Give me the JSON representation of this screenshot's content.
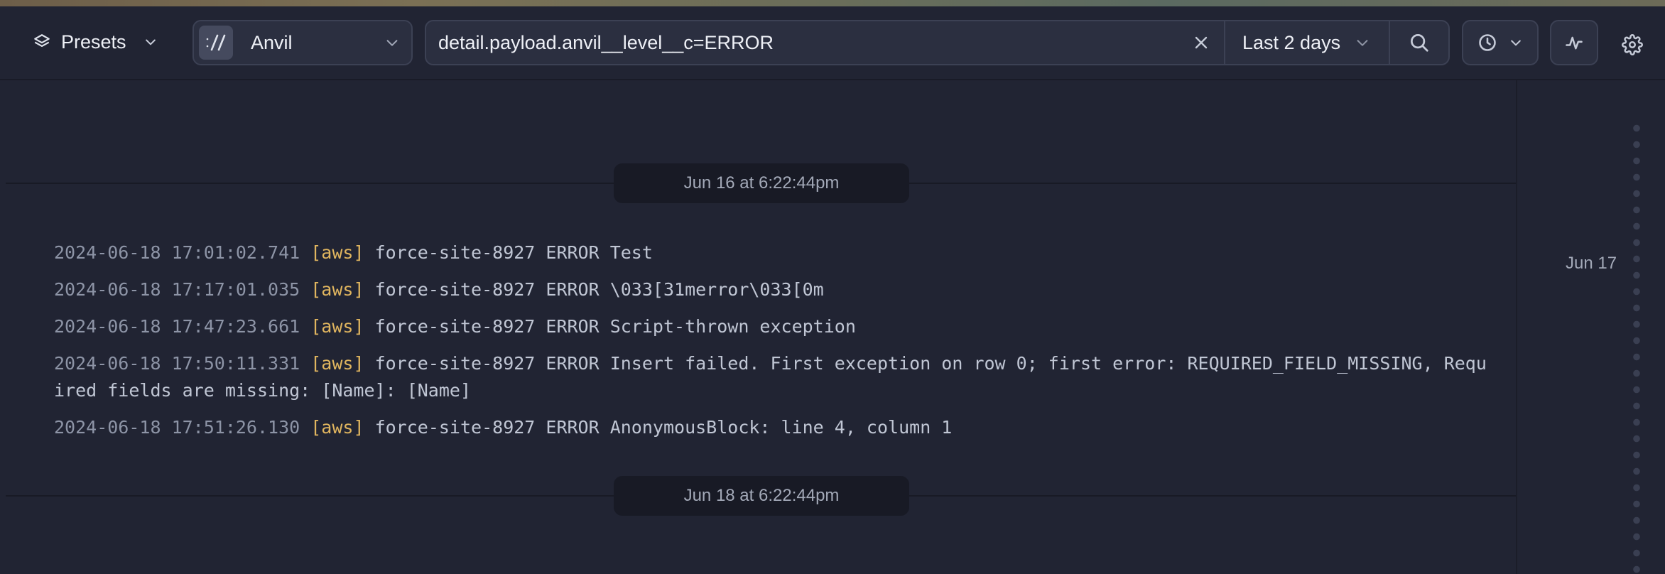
{
  "toolbar": {
    "presets_label": "Presets",
    "source_label": "Anvil",
    "query": "detail.payload.anvil__level__c=ERROR",
    "time_range": "Last 2 days"
  },
  "icons": {
    "presets": "layers-icon",
    "source": "slashes-icon",
    "clear": "close-icon",
    "search": "search-icon",
    "live": "clock-icon",
    "histogram": "activity-icon",
    "settings": "gear-icon"
  },
  "log": {
    "dividers": [
      "Jun 16 at 6:22:44pm",
      "Jun 18 at 6:22:44pm"
    ],
    "entries": [
      {
        "ts": "2024-06-18 17:01:02.741",
        "tag": "[aws]",
        "msg": "force-site-8927 ERROR Test"
      },
      {
        "ts": "2024-06-18 17:17:01.035",
        "tag": "[aws]",
        "msg": "force-site-8927 ERROR \\033[31merror\\033[0m"
      },
      {
        "ts": "2024-06-18 17:47:23.661",
        "tag": "[aws]",
        "msg": "force-site-8927 ERROR Script-thrown exception"
      },
      {
        "ts": "2024-06-18 17:50:11.331",
        "tag": "[aws]",
        "msg": "force-site-8927 ERROR Insert failed. First exception on row 0; first error: REQUIRED_FIELD_MISSING, Required fields are missing: [Name]: [Name]"
      },
      {
        "ts": "2024-06-18 17:51:26.130",
        "tag": "[aws]",
        "msg": "force-site-8927 ERROR AnonymousBlock: line 4, column 1"
      }
    ]
  },
  "timeline": {
    "date_label": "Jun 17"
  },
  "colors": {
    "background": "#212433",
    "tag": "#e0b55f",
    "timestamp": "#8d94a6"
  }
}
